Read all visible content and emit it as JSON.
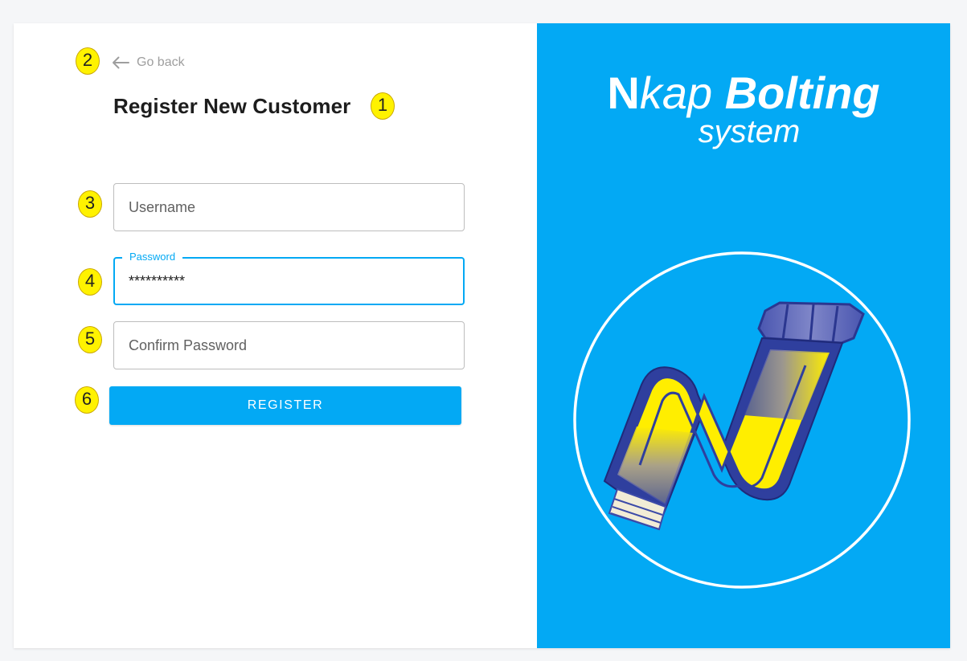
{
  "annotations": [
    "1",
    "2",
    "3",
    "4",
    "5",
    "6"
  ],
  "nav": {
    "go_back": "Go back"
  },
  "form": {
    "title": "Register New Customer",
    "username_placeholder": "Username",
    "password_label": "Password",
    "password_value": "**********",
    "confirm_placeholder": "Confirm Password",
    "register_label": "REGISTER"
  },
  "brand": {
    "n": "N",
    "kap": "kap",
    "bolting": "Bolting",
    "tagline": "system"
  },
  "colors": {
    "accent": "#03a9f4",
    "badge": "#fff200",
    "logo_yellow": "#ffee00",
    "logo_blue": "#2f3f9e"
  }
}
